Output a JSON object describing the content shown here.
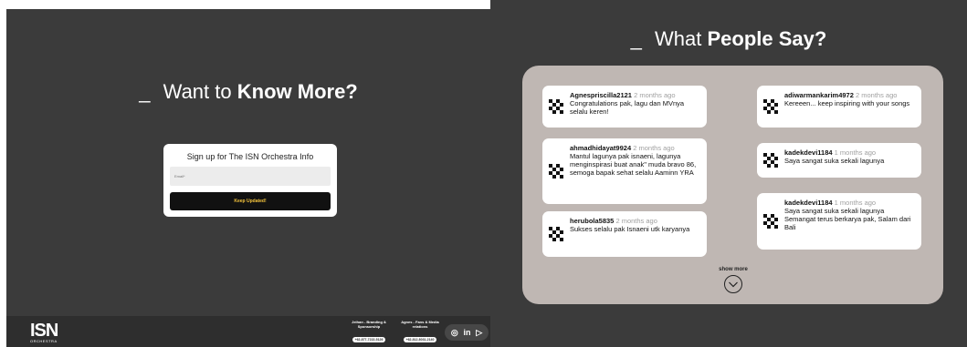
{
  "left_panel": {
    "title_dash": "_",
    "title_prefix": "Want to",
    "title_bold": "Know More?",
    "signup": {
      "title": "Sign up for The ISN Orchestra Info",
      "email_placeholder": "Email*",
      "button_label": "Keep Updated!"
    },
    "footer": {
      "logo_text": "ISN",
      "logo_subtext": "ORCHESTRA",
      "contacts": [
        {
          "name": "Jeihan - Branding & Sponsorship",
          "phone": "+62-877-7222-5126"
        },
        {
          "name": "Agnes - Fans & Media relations",
          "phone": "+62-812-8031-2140"
        }
      ],
      "social_icons": [
        "instagram-icon",
        "linkedin-icon",
        "youtube-icon"
      ],
      "social_glyphs": [
        "◎",
        "in",
        "▷"
      ]
    }
  },
  "right_panel": {
    "title_dash": "_",
    "title_prefix": "What",
    "title_bold": "People Say?",
    "reviews": [
      {
        "user": "Agnespriscilla2121",
        "ago": "2 months ago",
        "text": "Congratulations pak, lagu dan MVnya selalu keren!"
      },
      {
        "user": "ahmadhidayat9924",
        "ago": "2 months ago",
        "text": "Mantul lagunya pak isnaeni, lagunya menginspirasi buat anak\" muda bravo 86, semoga bapak sehat selalu Aaminn YRA"
      },
      {
        "user": "herubola5835",
        "ago": "2 months ago",
        "text": "Sukses selalu pak Isnaeni utk karyanya"
      },
      {
        "user": "adiwarmankarim4972",
        "ago": "2 months ago",
        "text": "Kereeen... keep inspiring with your songs"
      },
      {
        "user": "kadekdevi1184",
        "ago": "1 months ago",
        "text": "Saya sangat suka sekali lagunya"
      },
      {
        "user": "kadekdevi1184",
        "ago": "1 months ago",
        "text": "Saya sangat suka sekali lagunya Semangat terus berkarya pak, Salam dari Bali"
      }
    ],
    "show_more_label": "show more"
  }
}
